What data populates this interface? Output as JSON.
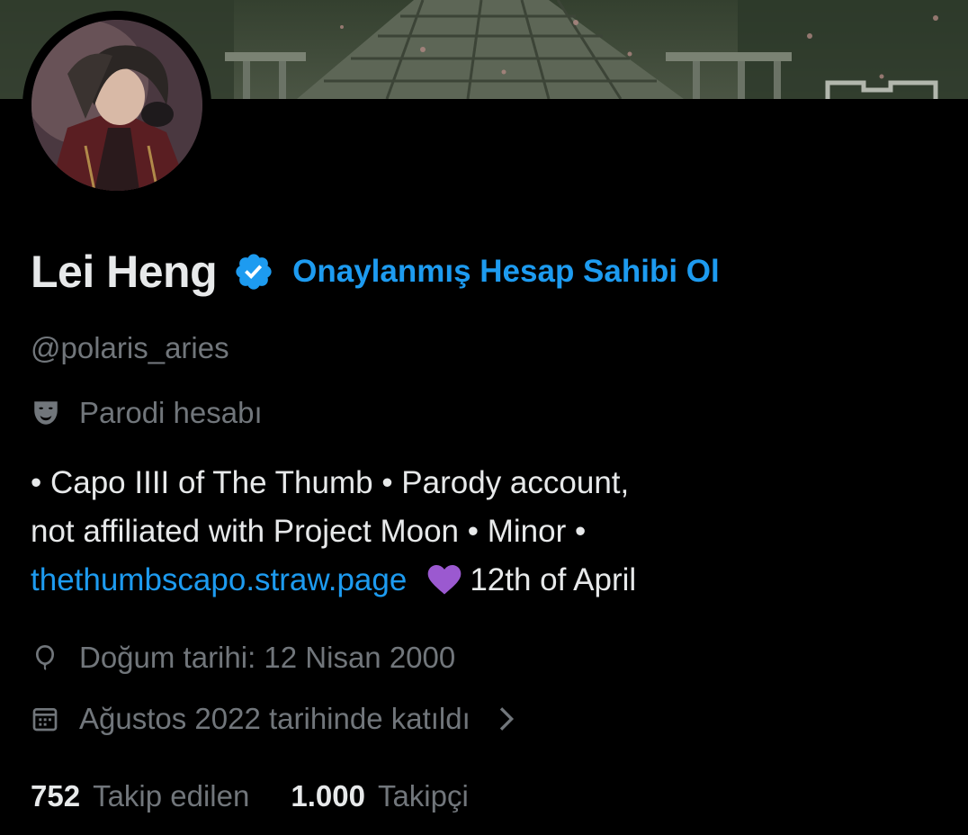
{
  "profile": {
    "display_name": "Lei Heng",
    "verify_cta": "Onaylanmış Hesap Sahibi Ol",
    "handle": "@polaris_aries",
    "parody_label": "Parodi hesabı",
    "bio": {
      "line1": "• Capo IIII of The Thumb  • Parody account,",
      "line2": "not affiliated with Project Moon  • Minor  •",
      "link": "thethumbscapo.straw.page",
      "line3_tail": "12th of April"
    },
    "birthday": "Doğum tarihi: 12 Nisan 2000",
    "joined": "Ağustos 2022 tarihinde katıldı",
    "following_count": "752",
    "following_label": "Takip edilen",
    "followers_count": "1.000",
    "followers_label": "Takipçi"
  },
  "icons": {
    "verified": "verified-badge-icon",
    "parody": "theater-mask-icon",
    "heart": "purple-heart-icon",
    "birthday": "balloon-icon",
    "joined": "calendar-icon",
    "chevron": "chevron-right-icon"
  },
  "colors": {
    "background": "#000000",
    "text_primary": "#e7e9ea",
    "text_secondary": "#71767b",
    "accent": "#1d9bf0",
    "heart": "#9b59d0"
  }
}
